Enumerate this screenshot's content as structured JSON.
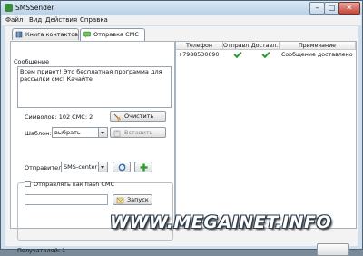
{
  "window": {
    "title": "SMSSender"
  },
  "menu": [
    "Файл",
    "Вид",
    "Действия",
    "Справка"
  ],
  "tabs": [
    {
      "label": "Книга контактов",
      "active": false
    },
    {
      "label": "Отправка СМС",
      "active": true
    }
  ],
  "message": {
    "legend": "Сообщение",
    "text": "Всем привет! Это бесплатная программа для рассылки смс! Качайте",
    "counter": "Символов: 102 СМС: 2",
    "clear_label": "Очистить",
    "template_label": "Шаблон:",
    "template_value": "выбрать",
    "insert_label": "Вставить"
  },
  "send": {
    "sender_label": "Отправитель:",
    "sender_value": "SMS-center",
    "flash_label": "Отправлять как flash СМС",
    "launch_label": "Запуск"
  },
  "table": {
    "columns": [
      "Телефон",
      "Отправл.",
      "Доставл.",
      "Примечание"
    ],
    "rows": [
      {
        "phone": "+7988530690",
        "sent": true,
        "delivered": true,
        "note": "Сообщение доставлено"
      }
    ]
  },
  "status": {
    "recipients": "Получателей: 1"
  },
  "watermark": "WWW.MEGAINET.INFO",
  "colors": {
    "check": "#2e9a2e",
    "accent": "#3b8c3b"
  },
  "icons": {
    "refresh": "refresh-icon",
    "add": "add-icon",
    "clear": "broom-icon",
    "launch": "send-icon"
  }
}
